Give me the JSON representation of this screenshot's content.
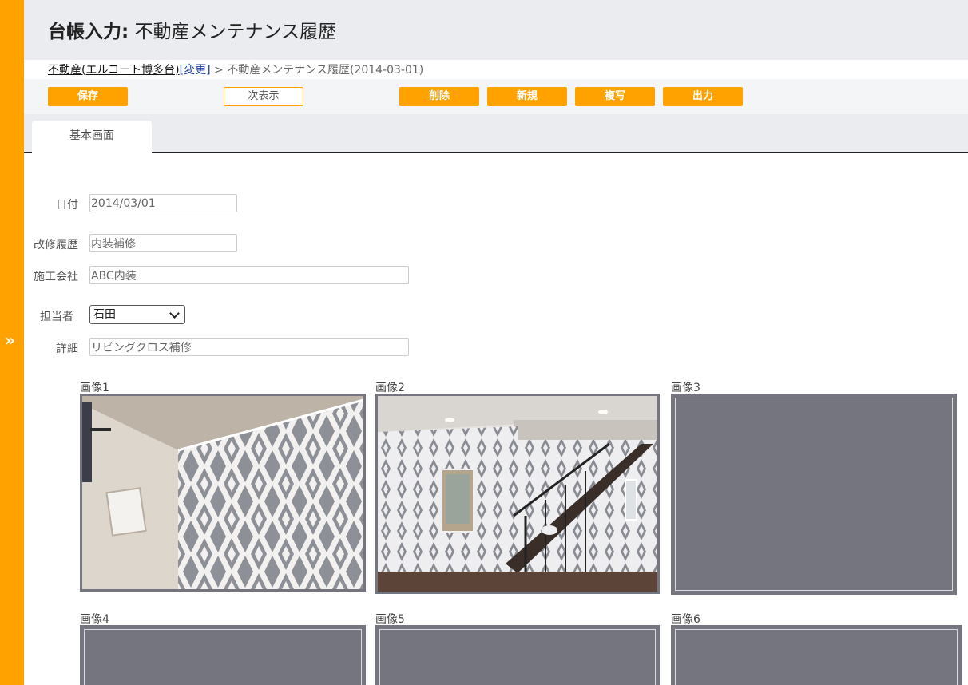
{
  "header": {
    "title_bold": "台帳入力:",
    "title": "不動産メンテナンス履歴"
  },
  "breadcrumb": {
    "parent_link": "不動産(エルコート博多台)",
    "change_link": "[変更]",
    "separator": ">",
    "current": "不動産メンテナンス履歴(2014-03-01)"
  },
  "toolbar": {
    "save": "保存",
    "next": "次表示",
    "delete": "削除",
    "new": "新規",
    "copy": "複写",
    "output": "出力"
  },
  "tabs": [
    {
      "label": "基本画面"
    }
  ],
  "form": {
    "date_label": "日付",
    "date_value": "2014/03/01",
    "renovation_label": "改修履歴",
    "renovation_value": "内装補修",
    "contractor_label": "施工会社",
    "contractor_value": "ABC内装",
    "person_label": "担当者",
    "person_value": "石田",
    "detail_label": "詳細",
    "detail_value": "リビングクロス補修"
  },
  "images": [
    {
      "label": "画像1",
      "has_photo": true,
      "photo": "room-wallpaper"
    },
    {
      "label": "画像2",
      "has_photo": true,
      "photo": "living-staircase"
    },
    {
      "label": "画像3",
      "has_photo": false
    },
    {
      "label": "画像4",
      "has_photo": false
    },
    {
      "label": "画像5",
      "has_photo": false
    },
    {
      "label": "画像6",
      "has_photo": false
    }
  ],
  "colors": {
    "accent": "#FFA200",
    "header_bg": "#EAECF0",
    "image_placeholder": "#75757F"
  },
  "icons": {
    "sidebar_toggle": "double-chevron-right-icon",
    "select_arrow": "chevron-down-icon"
  }
}
